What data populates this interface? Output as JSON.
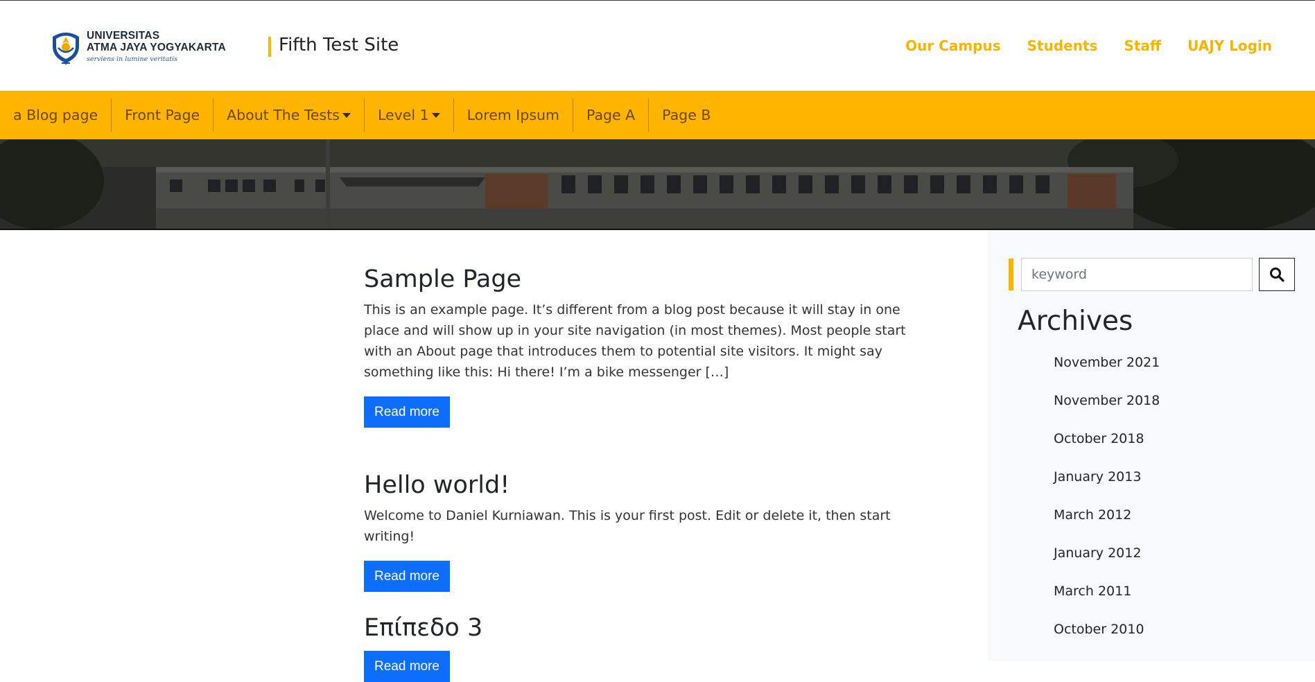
{
  "header": {
    "logo": {
      "line1": "UNIVERSITAS",
      "line2": "ATMA JAYA YOGYAKARTA",
      "tagline": "serviens in lumine veritatis"
    },
    "site_title": "Fifth Test Site",
    "top_nav": [
      "Our Campus",
      "Students",
      "Staff",
      "UAJY Login"
    ]
  },
  "menu": {
    "items": [
      {
        "label": "a Blog page",
        "dropdown": false
      },
      {
        "label": "Front Page",
        "dropdown": false
      },
      {
        "label": "About The Tests",
        "dropdown": true
      },
      {
        "label": "Level 1",
        "dropdown": true
      },
      {
        "label": "Lorem Ipsum",
        "dropdown": false
      },
      {
        "label": "Page A",
        "dropdown": false
      },
      {
        "label": "Page B",
        "dropdown": false
      }
    ]
  },
  "posts": [
    {
      "title": "Sample Page",
      "excerpt": "This is an example page. It’s different from a blog post because it will stay in one place and will show up in your site navigation (in most themes). Most people start with an About page that introduces them to potential site visitors. It might say something like this: Hi there! I’m a bike messenger […]",
      "button": "Read more"
    },
    {
      "title": "Hello world!",
      "excerpt": "Welcome to Daniel Kurniawan. This is your first post. Edit or delete it, then start writing!",
      "button": "Read more"
    },
    {
      "title": "Επίπεδο 3",
      "button": "Read more"
    }
  ],
  "sidebar": {
    "search": {
      "placeholder": "keyword",
      "value": ""
    },
    "archives_title": "Archives",
    "archives": [
      "November 2021",
      "November 2018",
      "October 2018",
      "January 2013",
      "March 2012",
      "January 2012",
      "March 2011",
      "October 2010"
    ]
  },
  "colors": {
    "accent_yellow": "#ffb400",
    "nav_link": "#f8b500",
    "button_blue": "#0d6efd",
    "sidebar_bg": "#f8f9fa"
  },
  "icons": {
    "search_button": "magnifier-icon",
    "dropdown": "caret-down-icon",
    "logo": "uajy-emblem-icon"
  }
}
